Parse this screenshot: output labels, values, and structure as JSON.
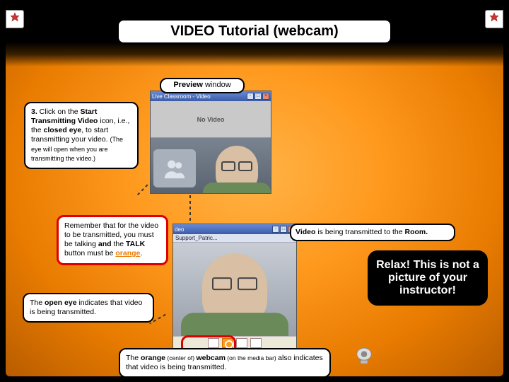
{
  "title": "VIDEO Tutorial (webcam)",
  "preview_label_a": "Preview",
  "preview_label_b": "window",
  "step3": {
    "num": "3.",
    "pre": " Click on the ",
    "bold1": "Start Transmitting Video",
    "mid1": " icon, i.e., the ",
    "bold2": "closed eye",
    "mid2": ", to start transmitting your video. ",
    "tail": "(The eye will open when you are transmitting the video.)"
  },
  "remember": {
    "pre": "Remember that for the video to be transmitted, you must be talking ",
    "bold1": "and",
    "mid": " the ",
    "bold2": "TALK",
    "post": " button must be ",
    "orange": "orange",
    "end": "."
  },
  "openeye": {
    "pre": "The ",
    "bold": "open eye",
    "post": " indicates that video is being transmitted."
  },
  "transmitted": {
    "bold": "Video",
    "mid": " is being transmitted to the ",
    "bold2": "Room.",
    "post": ""
  },
  "mediabar_msg": {
    "pre": "The ",
    "bold1": "orange",
    "sm1": " (center of) ",
    "bold2": "webcam",
    "sm2": " (on the media bar) ",
    "post": "also indicates that video is being transmitted."
  },
  "relax": "Relax! This is not a picture of your instructor!",
  "vidwin1": {
    "title": "Live Classroom - Video",
    "novideo": "No Video"
  },
  "vidwin2": {
    "title": "deo",
    "name": "Support_Patric..."
  }
}
